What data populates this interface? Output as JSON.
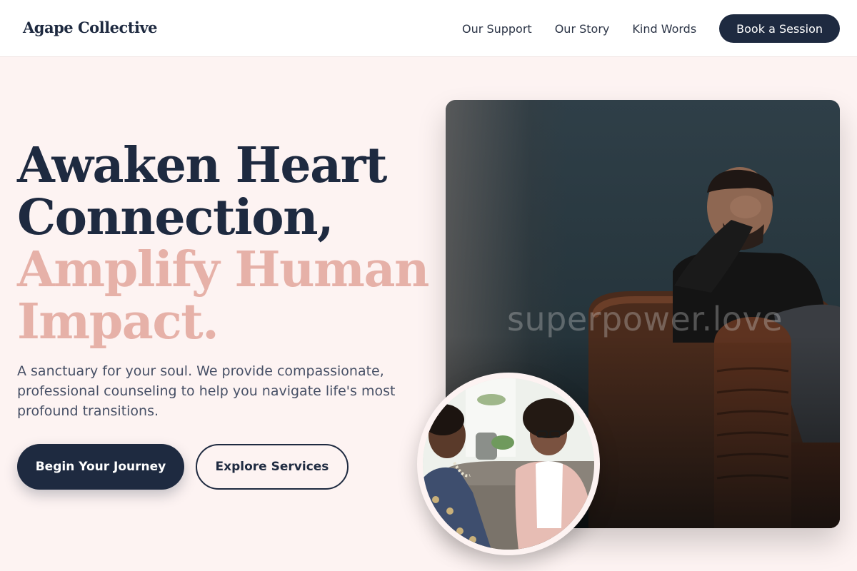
{
  "brand": {
    "name": "Agape Collective"
  },
  "nav": {
    "links": [
      "Our Support",
      "Our Story",
      "Kind Words"
    ],
    "cta": "Book a Session"
  },
  "hero": {
    "title_dark": [
      "Awaken Heart",
      "Connection,"
    ],
    "title_accent": [
      "Amplify Human",
      "Impact."
    ],
    "subtitle": "A sanctuary for your soul. We provide compassionate, professional counseling to help you navigate life's most profound transitions.",
    "primary_button": "Begin Your Journey",
    "secondary_button": "Explore Services"
  },
  "images": {
    "main_alt": "Man sitting in a leather armchair holding his head",
    "main_watermark": "superpower.love",
    "circle_alt": "Two women talking on a sofa during a counseling session"
  },
  "colors": {
    "navy": "#1e2a40",
    "accent_pink": "#e6b1a8",
    "background": "#fdf3f2"
  }
}
